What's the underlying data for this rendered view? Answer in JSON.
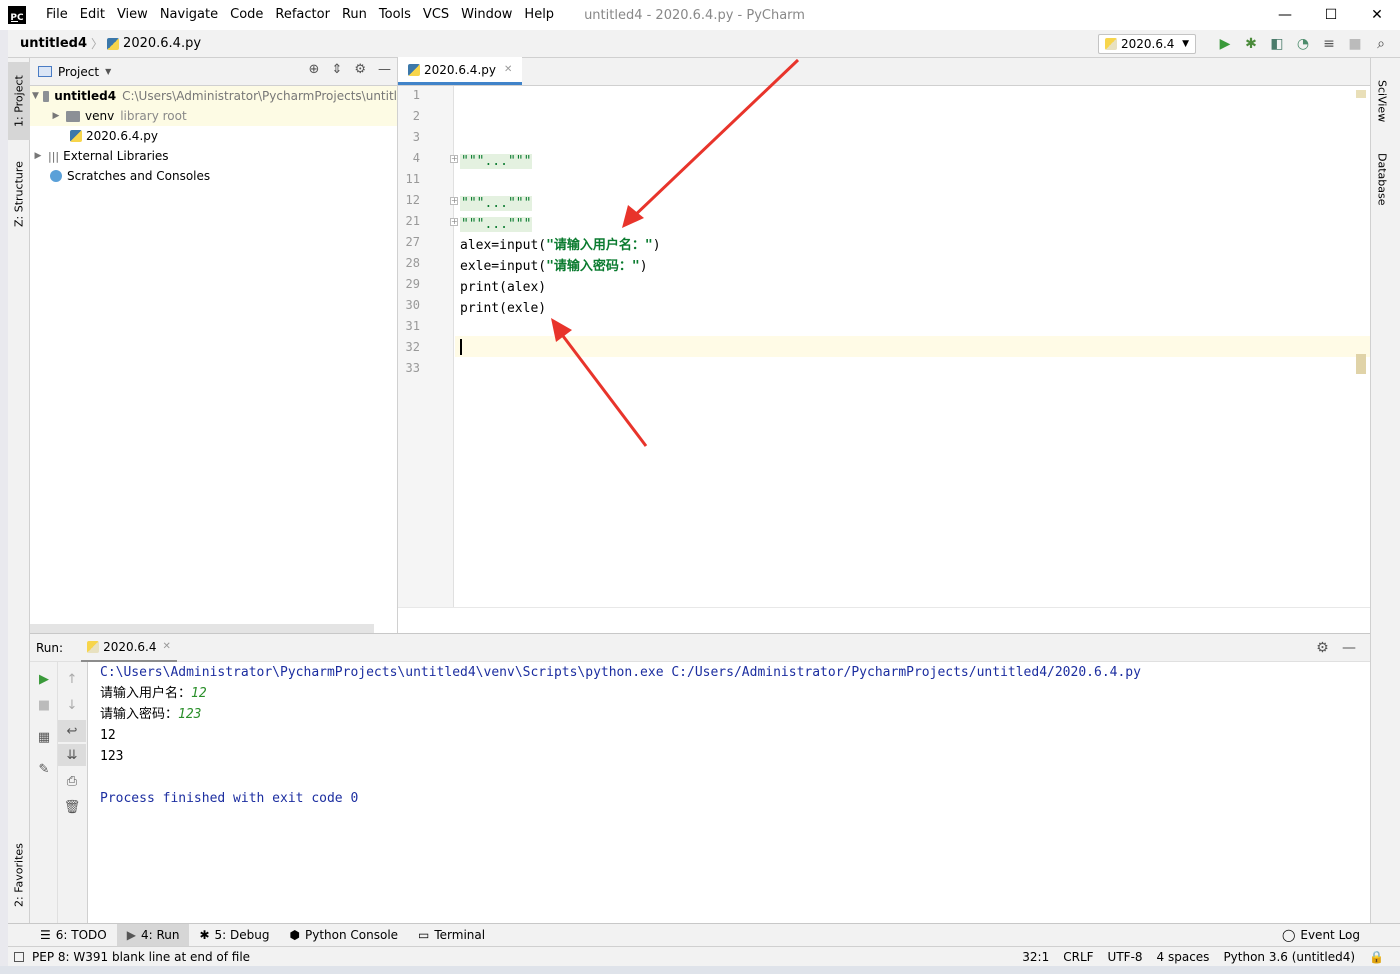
{
  "window": {
    "title": "untitled4 - 2020.6.4.py - PyCharm",
    "logo_text": "PC",
    "controls": {
      "minimize": "—",
      "maximize": "☐",
      "close": "✕"
    }
  },
  "menu": [
    "File",
    "Edit",
    "View",
    "Navigate",
    "Code",
    "Refactor",
    "Run",
    "Tools",
    "VCS",
    "Window",
    "Help"
  ],
  "navbar": {
    "project": "untitled4",
    "file": "2020.6.4.py",
    "run_config": "2020.6.4"
  },
  "left_stripe": {
    "project_tab": "1: Project",
    "structure_tab": "Z: Structure",
    "favorites_tab": "2: Favorites"
  },
  "right_stripe": {
    "sciview_tab": "SciView",
    "database_tab": "Database"
  },
  "project_panel": {
    "header": "Project",
    "tree": {
      "root_name": "untitled4",
      "root_path": "C:\\Users\\Administrator\\PycharmProjects\\untitl",
      "venv": "venv",
      "venv_hint": "library root",
      "file": "2020.6.4.py",
      "external": "External Libraries",
      "scratches": "Scratches and Consoles"
    }
  },
  "editor": {
    "tab": "2020.6.4.py",
    "line_numbers": [
      "1",
      "2",
      "3",
      "4",
      "11",
      "12",
      "21",
      "27",
      "28",
      "29",
      "30",
      "31",
      "32",
      "33"
    ],
    "folded": "\"\"\"...\"\"\"",
    "code": {
      "line27_a": "alex=input(",
      "line27_s": "\"请输入用户名：\"",
      "line27_b": ")",
      "line28_a": "exle=input(",
      "line28_s": "\"请输入密码：\"",
      "line28_b": ")",
      "line29": "print(alex)",
      "line30": "print(exle)"
    }
  },
  "run_panel": {
    "label": "Run:",
    "tab": "2020.6.4",
    "console": {
      "cmd": "C:\\Users\\Administrator\\PycharmProjects\\untitled4\\venv\\Scripts\\python.exe C:/Users/Administrator/PycharmProjects/untitled4/2020.6.4.py",
      "prompt1": "请输入用户名：",
      "input1": "12",
      "prompt2": "请输入密码：",
      "input2": "123",
      "out1": "12",
      "out2": "123",
      "finished": "Process finished with exit code 0"
    }
  },
  "bottom_tabs": {
    "todo": "6: TODO",
    "run": "4: Run",
    "debug": "5: Debug",
    "python_console": "Python Console",
    "terminal": "Terminal",
    "event_log": "Event Log"
  },
  "status": {
    "message": "PEP 8: W391 blank line at end of file",
    "position": "32:1",
    "line_sep": "CRLF",
    "encoding": "UTF-8",
    "indent": "4 spaces",
    "interpreter": "Python 3.6 (untitled4)"
  },
  "colors": {
    "accent": "#4083c9",
    "string": "#0a7b2f",
    "console_blue": "#1c2ea0",
    "input_green": "#2a8f2a",
    "annotation_red": "#e8342b"
  }
}
